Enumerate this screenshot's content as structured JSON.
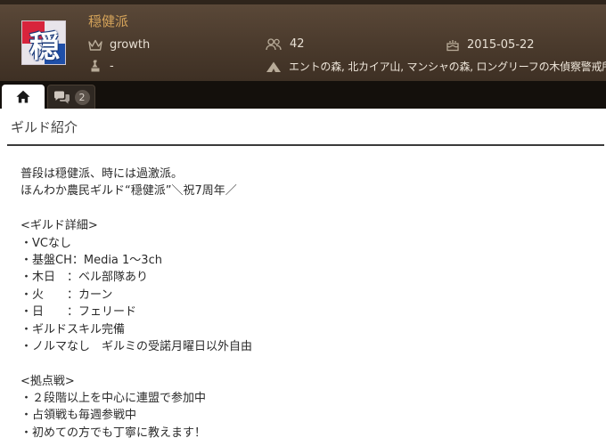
{
  "guild": {
    "emblem_char": "穏",
    "name": "穏健派",
    "master": "growth",
    "sub_master": "-",
    "members": "42",
    "founded": "2015-05-22",
    "places": "エントの森, 北カイア山, マンシャの森, ロングリーフの木偵察警戒所"
  },
  "icons": {
    "master": "crown-icon",
    "sub_master": "pawn-icon",
    "members": "users-icon",
    "founded": "cake-icon",
    "places": "tent-icon",
    "home_tab": "home-icon",
    "chat_tab": "chat-bubbles-icon"
  },
  "tabs": {
    "chat_count": "2"
  },
  "section": {
    "title": "ギルド紹介"
  },
  "intro_lines": [
    "普段は穏健派、時には過激派。",
    "ほんわか農民ギルド“穏健派”＼祝7周年／",
    "",
    "<ギルド詳細>",
    "・VCなし",
    "・基盤CH：Media 1～3ch",
    "・木日　：ベル部隊あり",
    "・火　　：カーン",
    "・日　　：フェリード",
    "・ギルドスキル完備",
    "・ノルマなし　ギルミの受諾月曜日以外自由",
    "",
    "<拠点戦>",
    "・２段階以上を中心に連盟で参加中",
    "・占領戦も毎週参戦中",
    "・初めての方でも丁寧に教えます！"
  ],
  "colors": {
    "header_bg": "#4a3a2c",
    "guild_name": "#d4a35a",
    "tabbar_bg": "#14100c",
    "emblem_red": "#d8243c",
    "emblem_blue": "#1f4fa8"
  }
}
